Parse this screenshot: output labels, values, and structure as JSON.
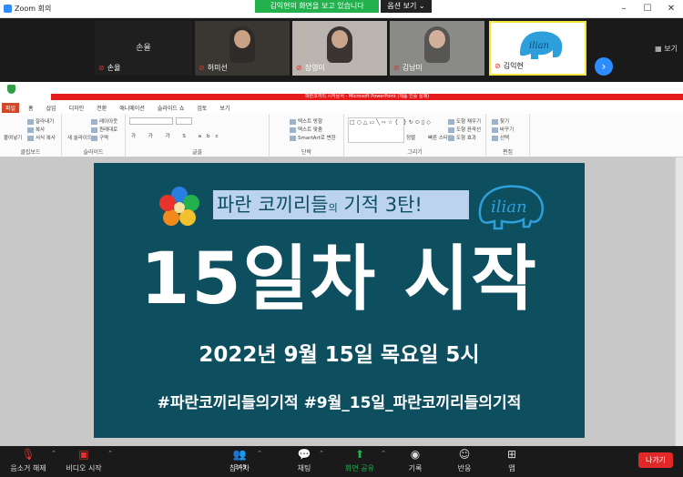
{
  "window": {
    "title": "Zoom 회의",
    "share_banner": "김익현의 화면을 보고 있습니다",
    "options_label": "옵션 보기 ⌄"
  },
  "gallery": {
    "view_label": "보기",
    "tiles": [
      {
        "name": "손율",
        "big_name": "손율"
      },
      {
        "name": "허미선"
      },
      {
        "name": "장영미"
      },
      {
        "name": "김남미"
      },
      {
        "name": "김익현"
      }
    ]
  },
  "ppt": {
    "title": "파란코끼리 시작문서 - Microsoft PowerPoint (제품 인증 실패)",
    "tabs": [
      "파일",
      "홈",
      "삽입",
      "디자인",
      "전환",
      "애니메이션",
      "슬라이드 쇼",
      "검토",
      "보기"
    ],
    "groups": [
      "클립보드",
      "슬라이드",
      "글꼴",
      "단락",
      "그리기",
      "편집"
    ],
    "clipboard_items": [
      "붙여넣기",
      "잘라내기",
      "복사",
      "서식 복사"
    ],
    "slide_items": [
      "새 슬라이드",
      "레이아웃",
      "원래대로",
      "구역"
    ],
    "paragraph_items": [
      "텍스트 방향",
      "텍스트 맞춤",
      "SmartArt로 변환"
    ],
    "drawing_items": [
      "정렬",
      "빠른 스타일",
      "도형 채우기",
      "도형 윤곽선",
      "도형 효과"
    ],
    "editing_items": [
      "찾기",
      "바꾸기",
      "선택"
    ]
  },
  "slide": {
    "heading_main": "파란 코끼리들",
    "heading_small": "의",
    "heading_rest": " 기적 3탄!",
    "logo_text": "ilian",
    "title": "15일차 시작",
    "date": "2022년 9월 15일 목요일 5시",
    "tags": "#파란코끼리들의기적 #9월_15일_파란코끼리들의기적"
  },
  "toolbar": {
    "mute": "음소거 해제",
    "video": "비디오 시작",
    "participants": "참가자",
    "participant_count": "349",
    "chat": "채팅",
    "share": "화면 공유",
    "record": "기록",
    "reactions": "반응",
    "apps": "앱",
    "leave": "나가기"
  },
  "colors": {
    "slide_bg": "#0e4f5f",
    "share_green": "#22b14c",
    "leave_red": "#e02828",
    "zoom_blue": "#2d8cff"
  }
}
